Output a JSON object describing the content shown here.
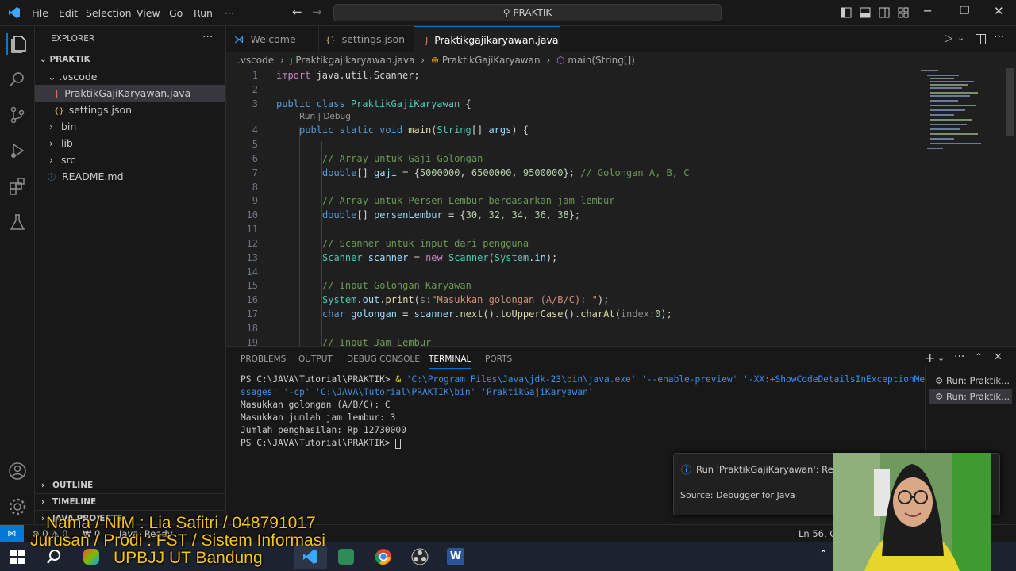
{
  "titlebar": {
    "menu": [
      "File",
      "Edit",
      "Selection",
      "View",
      "Go",
      "Run",
      "···"
    ],
    "search": "PRAKTIK"
  },
  "explorer": {
    "title": "EXPLORER",
    "root": "PRAKTIK",
    "items": [
      {
        "label": ".vscode",
        "kind": "folder-open"
      },
      {
        "label": "PraktikGajiKaryawan.java",
        "kind": "java"
      },
      {
        "label": "settings.json",
        "kind": "json"
      },
      {
        "label": "bin",
        "kind": "folder"
      },
      {
        "label": "lib",
        "kind": "folder"
      },
      {
        "label": "src",
        "kind": "folder"
      },
      {
        "label": "README.md",
        "kind": "md"
      }
    ],
    "sections": [
      "OUTLINE",
      "TIMELINE",
      "JAVA PROJECTS"
    ]
  },
  "tabs": [
    {
      "label": "Welcome",
      "icon": "vscode-icon"
    },
    {
      "label": "settings.json",
      "icon": "json-icon"
    },
    {
      "label": "Praktikgajikaryawan.java",
      "icon": "java-icon",
      "active": true
    }
  ],
  "breadcrumb": [
    ".vscode",
    "Praktikgajikaryawan.java",
    "PraktikGajiKaryawan",
    "main(String[])"
  ],
  "codelens": "Run | Debug",
  "code": {
    "line_numbers": [
      "1",
      "2",
      "3",
      "4",
      "5",
      "6",
      "7",
      "8",
      "9",
      "10",
      "11",
      "12",
      "13",
      "14",
      "15",
      "16",
      "17",
      "18",
      "19"
    ],
    "l1_kw": "import",
    "l1_rest": " java.util.Scanner;",
    "l3_kw": "public class",
    "l3_name": " PraktikGajiKaryawan",
    "l3_brace": " {",
    "l4_kw": "public static void",
    "l4_fn": " main",
    "l4_open": "(",
    "l4_type": "String",
    "l4_arr": "[] ",
    "l4_arg": "args",
    "l4_close": ") {",
    "l6": "// Array untuk Gaji Golongan",
    "l7_ty": "double",
    "l7_a": "[] ",
    "l7_var": "gaji",
    "l7_b": " = {",
    "l7_nums": "5000000, 6500000, 9500000",
    "l7_c": "}; ",
    "l7_cm": "// Golongan A, B, C",
    "l9": "// Array untuk Persen Lembur berdasarkan jam lembur",
    "l10_ty": "double",
    "l10_a": "[] ",
    "l10_var": "persenLembur",
    "l10_b": " = {",
    "l10_nums": "30, 32, 34, 36, 38",
    "l10_c": "};",
    "l12": "// Scanner untuk input dari pengguna",
    "l13_ty": "Scanner",
    "l13_var": " scanner",
    "l13_b": " = ",
    "l13_new": "new",
    "l13_ty2": " Scanner",
    "l13_c": "(",
    "l13_sys": "System",
    "l13_d": ".",
    "l13_in": "in",
    "l13_e": ");",
    "l15": "// Input Golongan Karyawan",
    "l16_sys": "System",
    "l16_a": ".",
    "l16_out": "out",
    "l16_b": ".",
    "l16_fn": "print",
    "l16_c": "(",
    "l16_hint": "s:",
    "l16_str": "\"Masukkan golongan (A/B/C): \"",
    "l16_d": ");",
    "l17_ty": "char",
    "l17_var": " golongan",
    "l17_b": " = ",
    "l17_sc": "scanner",
    "l17_c": ".",
    "l17_f1": "next",
    "l17_d": "().",
    "l17_f2": "toUpperCase",
    "l17_e": "().",
    "l17_f3": "charAt",
    "l17_f": "(",
    "l17_hint": "index:",
    "l17_num": "0",
    "l17_g": ");",
    "l19": "// Input Jam Lembur"
  },
  "panel": {
    "tabs": [
      "PROBLEMS",
      "OUTPUT",
      "DEBUG CONSOLE",
      "TERMINAL",
      "PORTS"
    ],
    "terminal": {
      "prompt1": "PS C:\\JAVA\\Tutorial\\PRAKTIK> ",
      "amp": "& ",
      "cmd_a": "'C:\\Program Files\\Java\\jdk-23\\bin\\java.exe'",
      "cmd_b": " '--enable-preview' '-XX:+ShowCodeDetailsInExceptionMe",
      "cmd_c": "ssages' '-cp' 'C:\\JAVA\\Tutorial\\PRAKTIK\\bin' 'PraktikGajiKaryawan'",
      "out1": "Masukkan golongan (A/B/C): C",
      "out2": "Masukkan jumlah jam lembur: 3",
      "out3": "Jumlah penghasilan: Rp 12730000",
      "prompt2": "PS C:\\JAVA\\Tutorial\\PRAKTIK> "
    },
    "sessions": [
      "Run: Praktik...",
      "Run: Praktik..."
    ]
  },
  "notification": {
    "title": "Run 'PraktikGajiKaryawan': Reso",
    "source": "Source: Debugger for Java"
  },
  "statusbar": {
    "problems": "⊗ 0 ⚠ 0",
    "ports": "₩ 0",
    "java": "Java: Ready",
    "position": "Ln 56, Co"
  },
  "overlay": {
    "line1": "Nama / NIM : Lia Safitri / 048791017",
    "line2": "Jurusan / Prodi : FST / Sistem Informasi",
    "line3": "UPBJJ UT Bandung"
  },
  "colors": {
    "accent": "#0078d4",
    "caption": "#f5c518"
  }
}
